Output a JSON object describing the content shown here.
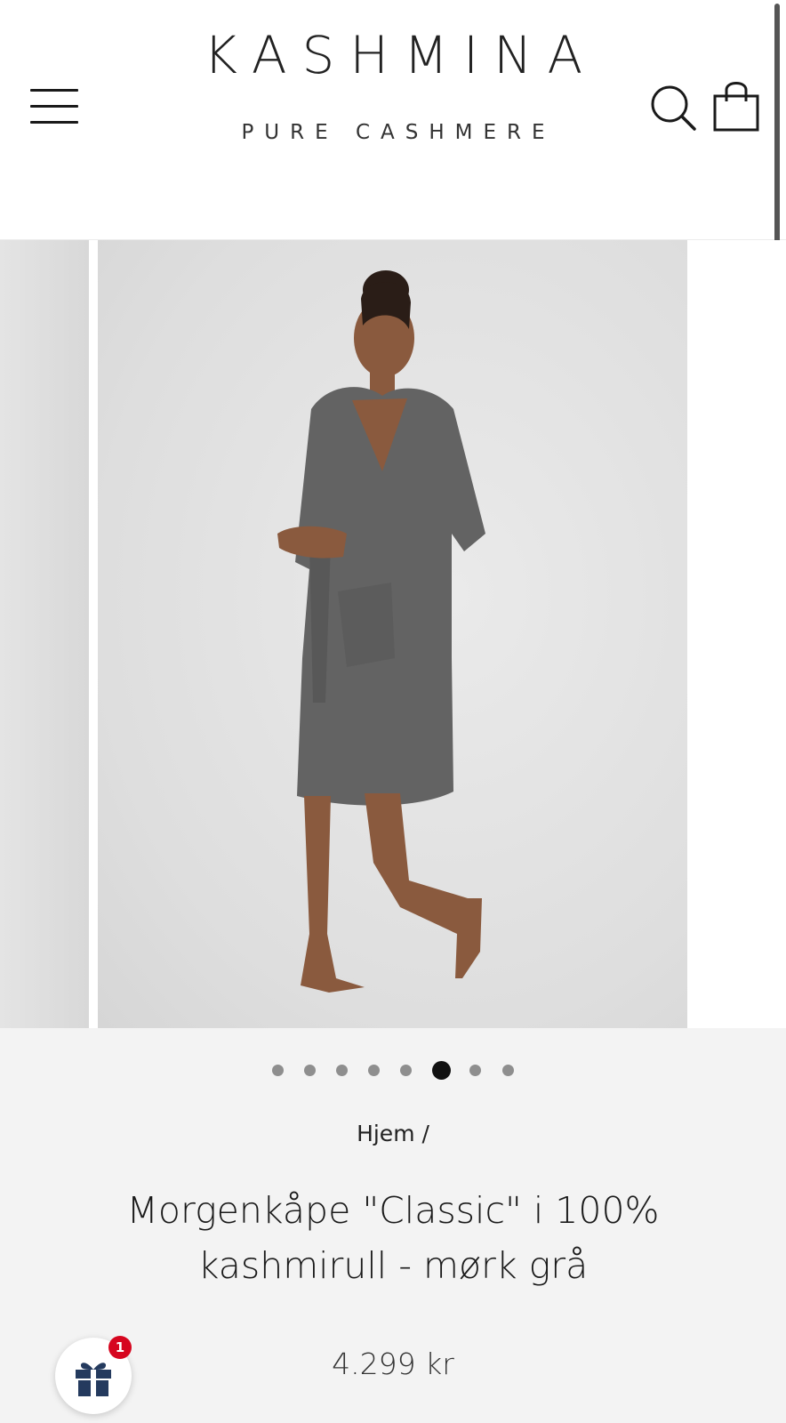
{
  "header": {
    "logo_main": "KASHMINA",
    "logo_sub": "PURE CASHMERE",
    "icons": {
      "menu": "hamburger-menu-icon",
      "search": "search-icon",
      "cart": "shopping-bag-icon"
    }
  },
  "gallery": {
    "slide_count": 8,
    "active_index": 5,
    "main_image_alt": "woman wearing dark grey cashmere robe",
    "zoom_icon": "magnifier-icon"
  },
  "breadcrumb": "Hjem /",
  "product": {
    "title": "Morgenkåpe \"Classic\" i 100% kashmirull - mørk grå",
    "price": "4.299 kr"
  },
  "gift_widget": {
    "icon": "gift-icon",
    "badge_count": "1",
    "badge_color": "#d6061f"
  }
}
